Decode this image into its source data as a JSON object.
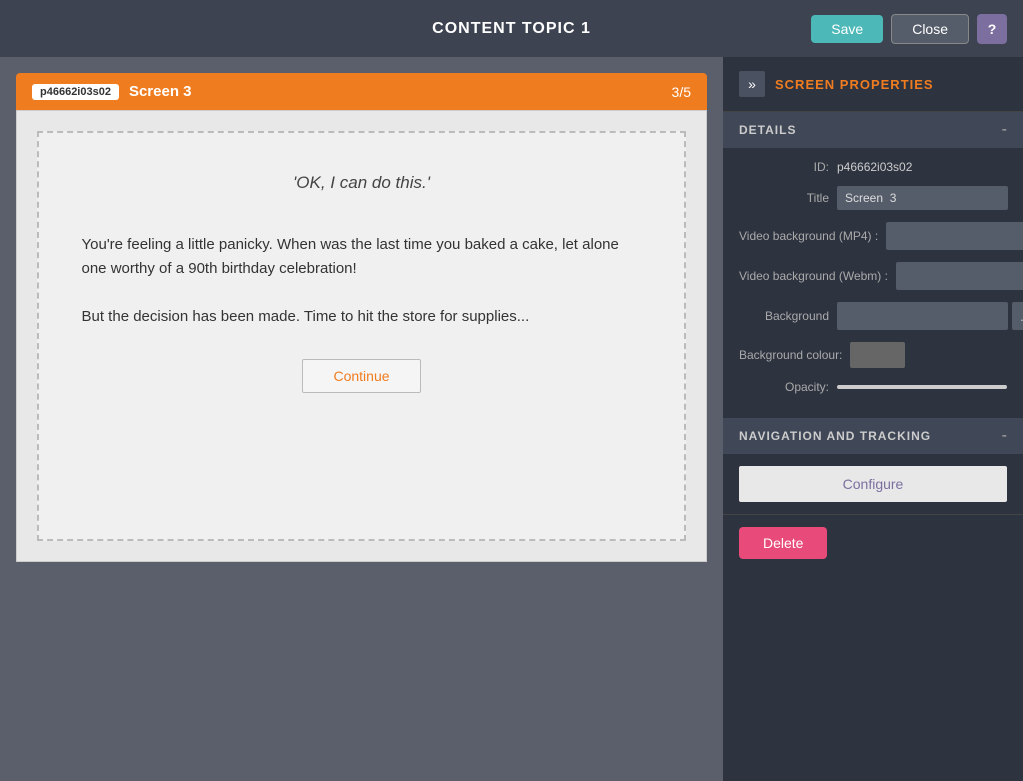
{
  "header": {
    "title": "CONTENT TOPIC 1",
    "save_label": "Save",
    "close_label": "Close",
    "help_label": "?"
  },
  "screen_header": {
    "id_badge": "p46662i03s02",
    "screen_name": "Screen 3",
    "counter": "3/5"
  },
  "screen_content": {
    "quote": "'OK, I can do this.'",
    "body_paragraph1": "You're feeling a little panicky. When was the last time you baked a cake, let alone one worthy of a 90th birthday celebration!",
    "body_paragraph2": "But the decision has been made. Time to hit the store for supplies...",
    "continue_label": "Continue"
  },
  "right_panel": {
    "title": "SCREEN PROPERTIES",
    "collapse_icon": "»",
    "sections": {
      "details": {
        "label": "DETAILS",
        "id_label": "ID:",
        "id_value": "p46662i03s02",
        "title_label": "Title",
        "title_value": "Screen  3",
        "video_mp4_label": "Video background (MP4) :",
        "video_webm_label": "Video background (Webm) :",
        "background_label": "Background",
        "bg_colour_label": "Background colour:",
        "opacity_label": "Opacity:",
        "dots_icon": "…",
        "crop_icon": "⊞"
      },
      "navigation": {
        "label": "NAVIGATION AND TRACKING",
        "configure_label": "Configure"
      }
    },
    "delete_label": "Delete",
    "minus_icon": "-"
  }
}
